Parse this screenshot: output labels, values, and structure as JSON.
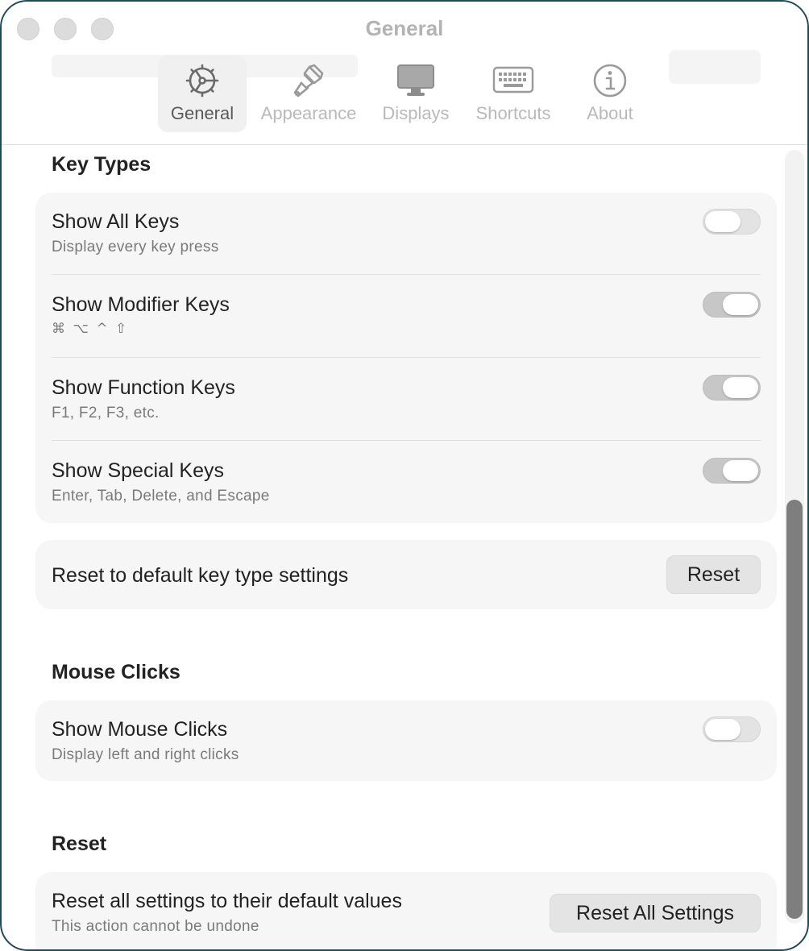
{
  "window": {
    "title": "General"
  },
  "tabs": [
    {
      "label": "General",
      "icon": "gear-icon",
      "active": true
    },
    {
      "label": "Appearance",
      "icon": "paintbrush-icon",
      "active": false
    },
    {
      "label": "Displays",
      "icon": "display-icon",
      "active": false
    },
    {
      "label": "Shortcuts",
      "icon": "keyboard-icon",
      "active": false
    },
    {
      "label": "About",
      "icon": "info-icon",
      "active": false
    }
  ],
  "key_types": {
    "title": "Key Types",
    "items": [
      {
        "title": "Show All Keys",
        "subtitle": "Display every key press",
        "enabled": false
      },
      {
        "title": "Show Modifier Keys",
        "subtitle": "⌘ ⌥ ^ ⇧",
        "enabled": true
      },
      {
        "title": "Show Function Keys",
        "subtitle": "F1, F2, F3, etc.",
        "enabled": true
      },
      {
        "title": "Show Special Keys",
        "subtitle": "Enter, Tab, Delete, and Escape",
        "enabled": true
      }
    ],
    "reset_row": {
      "label": "Reset to default key type settings",
      "button": "Reset"
    }
  },
  "mouse_clicks": {
    "title": "Mouse Clicks",
    "items": [
      {
        "title": "Show Mouse Clicks",
        "subtitle": "Display left and right clicks",
        "enabled": false
      }
    ]
  },
  "reset": {
    "title": "Reset",
    "row": {
      "title": "Reset all settings to their default values",
      "subtitle": "This action cannot be undone",
      "button": "Reset All Settings"
    }
  },
  "colors": {
    "window_border": "#1f4a5c",
    "card_bg": "#f6f6f6",
    "scroll_thumb": "#7e7e7e"
  }
}
